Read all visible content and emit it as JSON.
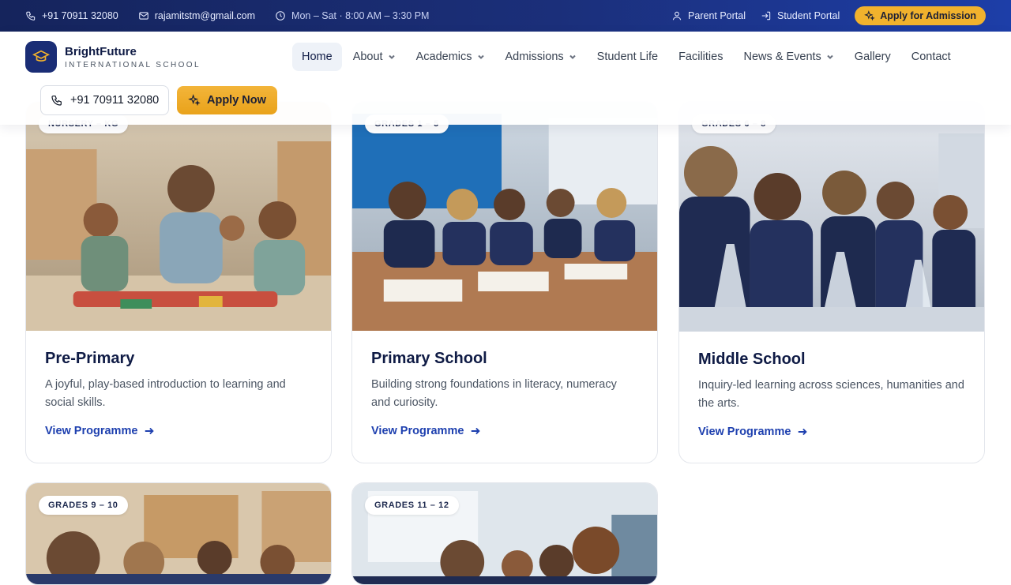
{
  "topbar": {
    "phone": "+91 70911 32080",
    "email": "rajamitstm@gmail.com",
    "hours": "Mon – Sat · 8:00 AM – 3:30 PM",
    "parent_portal": "Parent Portal",
    "student_portal": "Student Portal",
    "apply_admission": "Apply for Admission"
  },
  "brand": {
    "name": "BrightFuture",
    "subtitle": "INTERNATIONAL SCHOOL"
  },
  "nav": {
    "items": [
      {
        "label": "Home",
        "active": true
      },
      {
        "label": "About",
        "dropdown": true
      },
      {
        "label": "Academics",
        "dropdown": true
      },
      {
        "label": "Admissions",
        "dropdown": true
      },
      {
        "label": "Student Life"
      },
      {
        "label": "Facilities"
      },
      {
        "label": "News & Events",
        "dropdown": true
      },
      {
        "label": "Gallery"
      },
      {
        "label": "Contact"
      }
    ],
    "phone_button": "+91 70911 32080",
    "apply_button": "Apply Now"
  },
  "programmes": [
    {
      "badge": "NURSERY – KG",
      "title": "Pre-Primary",
      "description": "A joyful, play-based introduction to learning and social skills.",
      "link": "View Programme"
    },
    {
      "badge": "GRADES 1 – 5",
      "title": "Primary School",
      "description": "Building strong foundations in literacy, numeracy and curiosity.",
      "link": "View Programme"
    },
    {
      "badge": "GRADES 6 – 8",
      "title": "Middle School",
      "description": "Inquiry-led learning across sciences, humanities and the arts.",
      "link": "View Programme"
    },
    {
      "badge": "GRADES 9 – 10"
    },
    {
      "badge": "GRADES 11 – 12"
    }
  ],
  "colors": {
    "topbar": "#1b2f7a",
    "accent": "#f1b22d",
    "link": "#1e40af",
    "heading": "#0f1b45"
  }
}
